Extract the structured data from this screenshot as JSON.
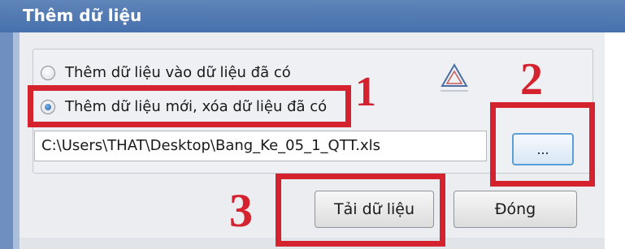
{
  "dialog": {
    "title": "Thêm dữ liệu"
  },
  "options": {
    "append_label": "Thêm dữ liệu vào dữ liệu đã có",
    "replace_label": "Thêm dữ liệu mới, xóa dữ liệu đã có",
    "selected": "replace"
  },
  "file": {
    "path": "C:\\Users\\THAT\\Desktop\\Bang_Ke_05_1_QTT.xls",
    "browse_label": "..."
  },
  "buttons": {
    "load_label": "Tải dữ liệu",
    "close_label": "Đóng"
  },
  "annotations": {
    "step1": "1",
    "step2": "2",
    "step3": "3",
    "color": "#d4232f"
  },
  "icons": {
    "logo": "triangle-logo-icon"
  }
}
